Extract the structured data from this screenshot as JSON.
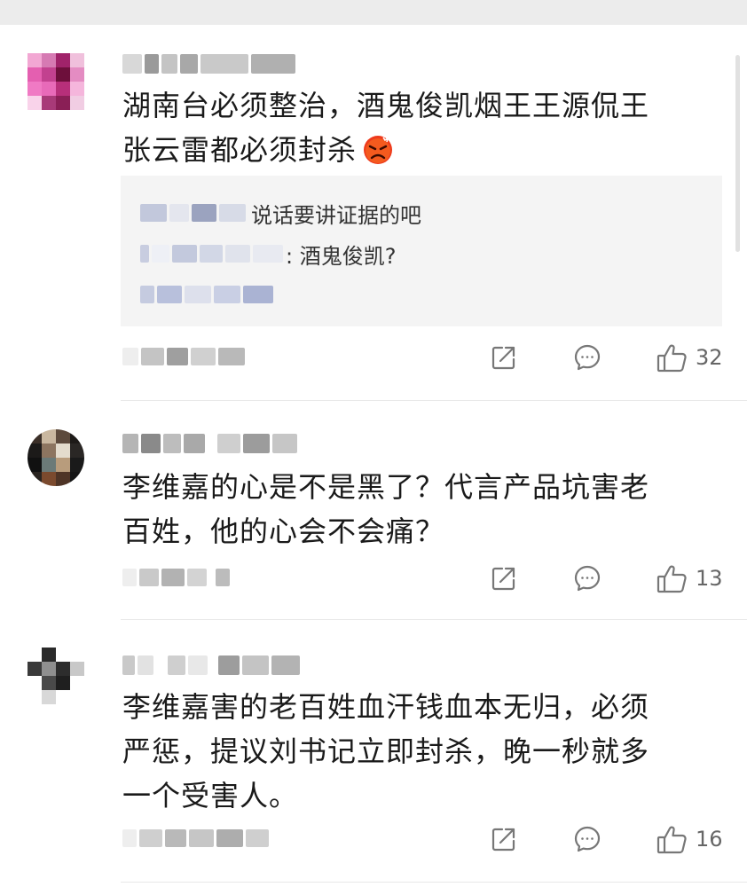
{
  "colors": {
    "background": "#ffffff",
    "reply_bg": "#f4f4f4",
    "icon": "#777777",
    "text": "#1a1a1a"
  },
  "icons": {
    "share": "share-icon",
    "comment": "comment-icon",
    "like": "like-icon",
    "emoji": "angry-face-emoji"
  },
  "comments": [
    {
      "text_lines": [
        "湖南台必须整治，酒鬼俊凯烟王王源侃王",
        "张云雷都必须封杀"
      ],
      "replies": [
        {
          "text": "说话要讲证据的吧"
        },
        {
          "text": ": 酒鬼俊凯?"
        }
      ],
      "likes": "32"
    },
    {
      "text_lines": [
        "李维嘉的心是不是黑了？代言产品坑害老",
        "百姓，他的心会不会痛？"
      ],
      "likes": "13"
    },
    {
      "text_lines": [
        "李维嘉害的老百姓血汗钱血本无归，必须",
        "严惩，提议刘书记立即封杀，晚一秒就多",
        "一个受害人。"
      ],
      "likes": "16"
    }
  ]
}
